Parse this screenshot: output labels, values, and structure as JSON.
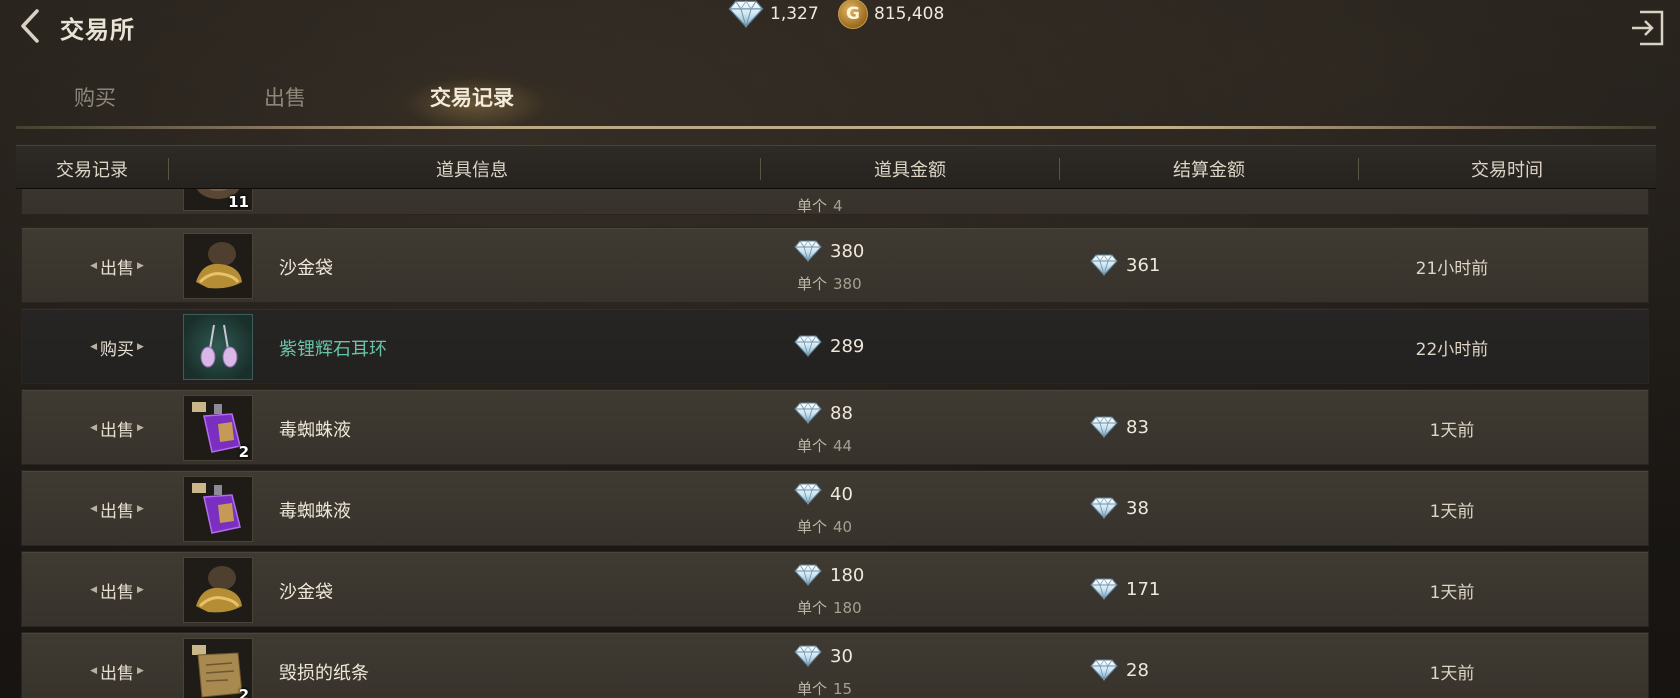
{
  "header": {
    "title": "交易所",
    "diamonds": "1,327",
    "gold": "815,408",
    "gold_symbol": "G"
  },
  "tabs": [
    {
      "label": "购买",
      "active": false
    },
    {
      "label": "出售",
      "active": false
    },
    {
      "label": "交易记录",
      "active": true
    }
  ],
  "table": {
    "columns": [
      "交易记录",
      "道具信息",
      "道具金额",
      "结算金额",
      "交易时间"
    ],
    "partial_row": {
      "qty": "11",
      "unit_label": "单个",
      "unit_price": "4"
    },
    "rows": [
      {
        "type": "出售",
        "name": "沙金袋",
        "icon": "gold-sand-bag-icon",
        "qty": "",
        "price": "380",
        "unit_label": "单个",
        "unit_price": "380",
        "settle": "361",
        "time": "21小时前"
      },
      {
        "type": "购买",
        "name": "紫锂辉石耳环",
        "icon": "kunzite-earring-icon",
        "qty": "",
        "price": "289",
        "unit_label": "",
        "unit_price": "",
        "settle": "",
        "time": "22小时前"
      },
      {
        "type": "出售",
        "name": "毒蜘蛛液",
        "icon": "poison-vial-icon",
        "qty": "2",
        "price": "88",
        "unit_label": "单个",
        "unit_price": "44",
        "settle": "83",
        "time": "1天前"
      },
      {
        "type": "出售",
        "name": "毒蜘蛛液",
        "icon": "poison-vial-icon",
        "qty": "",
        "price": "40",
        "unit_label": "单个",
        "unit_price": "40",
        "settle": "38",
        "time": "1天前"
      },
      {
        "type": "出售",
        "name": "沙金袋",
        "icon": "gold-sand-bag-icon",
        "qty": "",
        "price": "180",
        "unit_label": "单个",
        "unit_price": "180",
        "settle": "171",
        "time": "1天前"
      },
      {
        "type": "出售",
        "name": "毁损的纸条",
        "icon": "torn-paper-icon",
        "qty": "2",
        "price": "30",
        "unit_label": "单个",
        "unit_price": "15",
        "settle": "28",
        "time": "1天前"
      }
    ]
  },
  "colors": {
    "accent_text": "#efe8da",
    "rare_item": "#69c2a7",
    "row_sell": "#3d3830",
    "row_buy": "#242322"
  }
}
